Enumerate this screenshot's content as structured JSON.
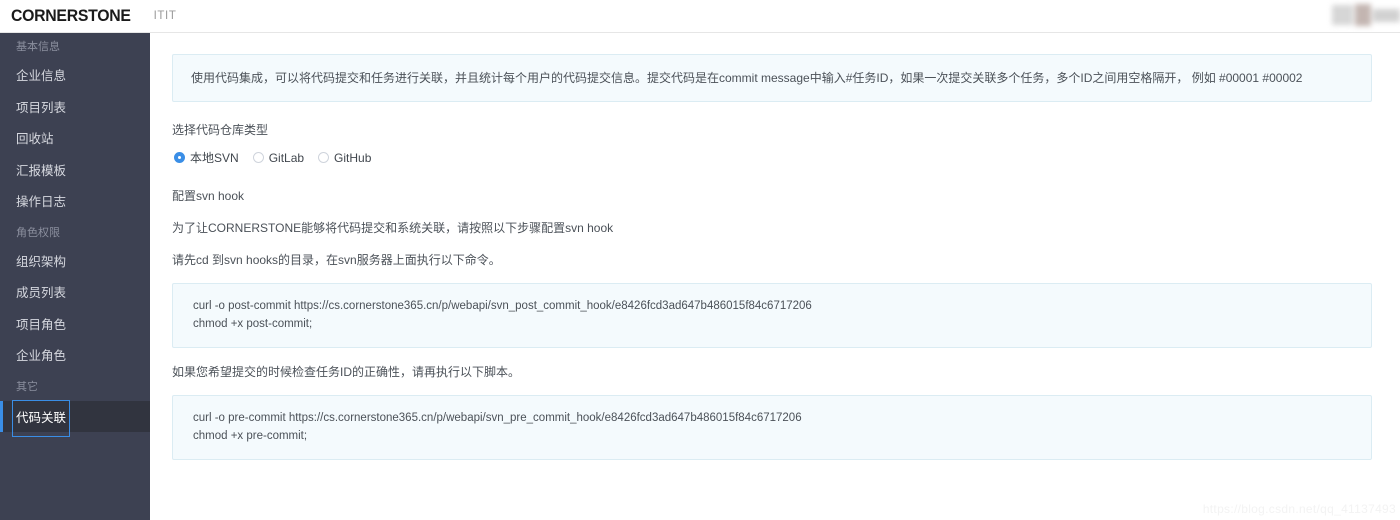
{
  "header": {
    "logo": "CORNERSTONE",
    "org_name": "ITIT"
  },
  "sidebar": {
    "groups": [
      {
        "title": "基本信息",
        "items": [
          {
            "label": "企业信息",
            "active": false
          },
          {
            "label": "项目列表",
            "active": false
          },
          {
            "label": "回收站",
            "active": false
          },
          {
            "label": "汇报模板",
            "active": false
          },
          {
            "label": "操作日志",
            "active": false
          }
        ]
      },
      {
        "title": "角色权限",
        "items": [
          {
            "label": "组织架构",
            "active": false
          },
          {
            "label": "成员列表",
            "active": false
          },
          {
            "label": "项目角色",
            "active": false
          },
          {
            "label": "企业角色",
            "active": false
          }
        ]
      },
      {
        "title": "其它",
        "items": [
          {
            "label": "代码关联",
            "active": true
          }
        ]
      }
    ]
  },
  "main": {
    "banner": "使用代码集成，可以将代码提交和任务进行关联，并且统计每个用户的代码提交信息。提交代码是在commit message中输入#任务ID，如果一次提交关联多个任务，多个ID之间用空格隔开，  例如 #00001 #00002",
    "repo_type_label": "选择代码仓库类型",
    "repo_types": [
      {
        "label": "本地SVN",
        "checked": true
      },
      {
        "label": "GitLab",
        "checked": false
      },
      {
        "label": "GitHub",
        "checked": false
      }
    ],
    "hook_section_title": "配置svn hook",
    "hook_intro": "为了让CORNERSTONE能够将代码提交和系统关联，请按照以下步骤配置svn hook",
    "hook_step": "请先cd 到svn hooks的目录，在svn服务器上面执行以下命令。",
    "post_commit_code": {
      "line1": "curl -o post-commit https://cs.cornerstone365.cn/p/webapi/svn_post_commit_hook/e8426fcd3ad647b486015f84c6717206",
      "line2": "chmod +x post-commit;"
    },
    "pre_commit_intro": "如果您希望提交的时候检查任务ID的正确性，请再执行以下脚本。",
    "pre_commit_code": {
      "line1": "curl -o pre-commit https://cs.cornerstone365.cn/p/webapi/svn_pre_commit_hook/e8426fcd3ad647b486015f84c6717206",
      "line2": "chmod +x pre-commit;"
    }
  },
  "watermark": "https://blog.csdn.net/qq_41137493",
  "colors": {
    "sidebar_bg": "#3d4152",
    "sidebar_active_bg": "#31343f",
    "accent": "#3a8ee6",
    "panel_bg": "#f4fafd",
    "panel_border": "#dbecf3"
  }
}
